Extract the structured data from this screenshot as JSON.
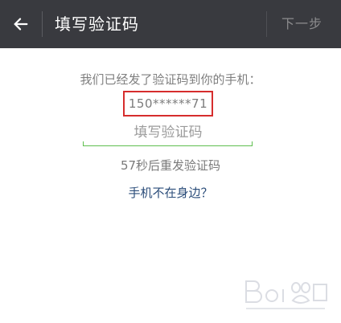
{
  "header": {
    "back_icon": "back-arrow-icon",
    "title": "填写验证码",
    "next_label": "下一步"
  },
  "content": {
    "sent_message": "我们已经发了验证码到你的手机：",
    "phone_number": "150******71",
    "code_placeholder": "填写验证码",
    "resend_text": "57秒后重发验证码",
    "phone_not_around": "手机不在身边？"
  },
  "colors": {
    "header_bg": "#393a3f",
    "accent_green": "#5fbf4f",
    "highlight_red": "#d62d2d",
    "link_blue": "#2b4d7a"
  }
}
